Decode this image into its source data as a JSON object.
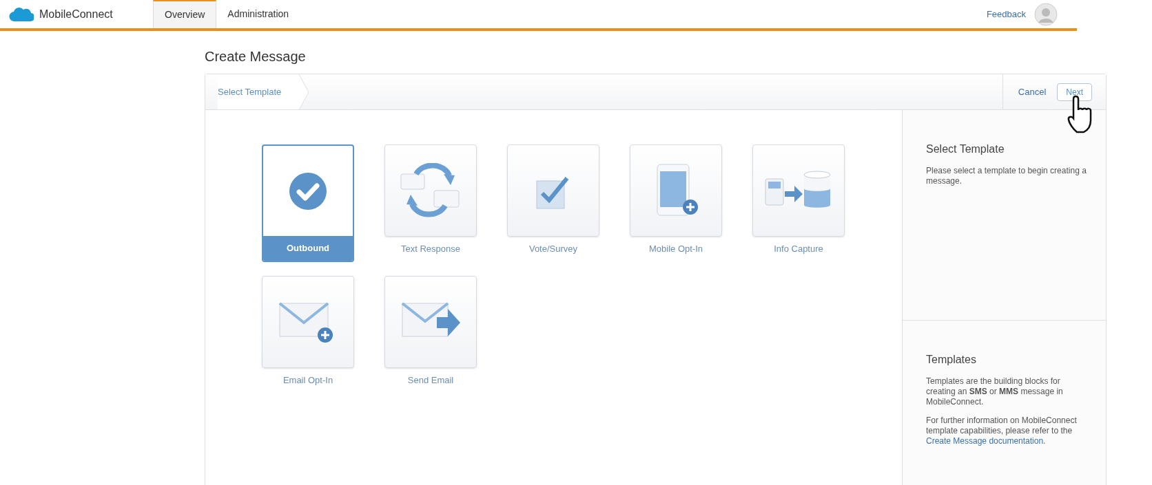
{
  "app": {
    "name": "MobileConnect"
  },
  "nav_tabs": [
    {
      "label": "Overview",
      "selected": true
    },
    {
      "label": "Administration",
      "selected": false
    }
  ],
  "feedback": "Feedback",
  "page_title": "Create Message",
  "step": {
    "label": "Select Template"
  },
  "actions": {
    "cancel": "Cancel",
    "next": "Next"
  },
  "templates": [
    {
      "label": "Outbound",
      "kind": "outbound",
      "selected": true
    },
    {
      "label": "Text Response",
      "kind": "text_response",
      "selected": false
    },
    {
      "label": "Vote/Survey",
      "kind": "vote",
      "selected": false
    },
    {
      "label": "Mobile Opt-In",
      "kind": "mobile_optin",
      "selected": false
    },
    {
      "label": "Info Capture",
      "kind": "info_capture",
      "selected": false
    },
    {
      "label": "Email Opt-In",
      "kind": "email_optin",
      "selected": false
    },
    {
      "label": "Send Email",
      "kind": "send_email",
      "selected": false
    }
  ],
  "sidebar": {
    "help_title": "Select Template",
    "help_text": "Please select a template to begin creating a message.",
    "info_title": "Templates",
    "info_text": "Templates are the building blocks for creating an **SMS** or **MMS** message in MobileConnect.",
    "info_more": "For further information on MobileConnect template capabilities, please refer to the",
    "info_link": "Create Message documentation",
    "info_end": "."
  }
}
